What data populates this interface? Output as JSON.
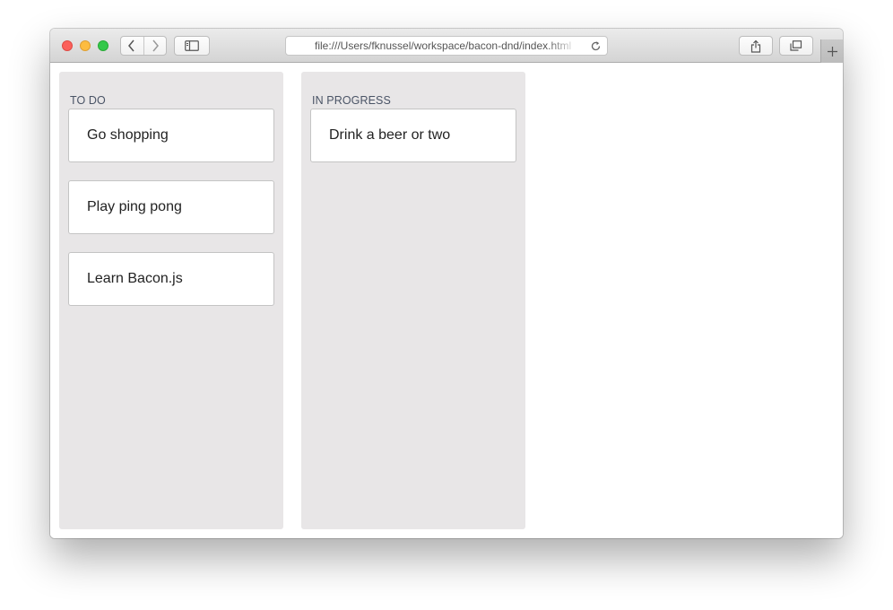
{
  "browser": {
    "url": "file:///Users/fknussel/workspace/bacon-dnd/index.html",
    "icons": {
      "back": "chevron-left-icon",
      "forward": "chevron-right-icon",
      "sidebar": "sidebar-icon",
      "share": "share-icon",
      "tabs": "tabs-overview-icon",
      "reload": "reload-icon",
      "new_tab": "plus-icon"
    }
  },
  "board": {
    "columns": [
      {
        "title": "TO DO",
        "cards": [
          "Go shopping",
          "Play ping pong",
          "Learn Bacon.js"
        ]
      },
      {
        "title": "IN PROGRESS",
        "cards": [
          "Drink a beer or two"
        ]
      }
    ]
  },
  "colors": {
    "column_bg": "#e8e6e7",
    "column_title": "#4a5466",
    "card_border": "#c4c4c4"
  }
}
